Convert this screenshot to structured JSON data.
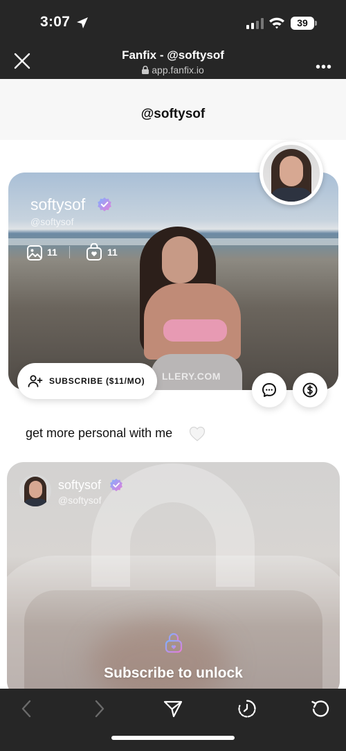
{
  "status_bar": {
    "time": "3:07",
    "battery": "39"
  },
  "browser": {
    "title": "Fanfix - @softysof",
    "url": "app.fanfix.io"
  },
  "page": {
    "title": "@softysof"
  },
  "profile": {
    "name": "softysof",
    "handle": "@softysof",
    "photo_count": "11",
    "bundle_count": "11",
    "watermark": "LLERY.COM",
    "subscribe_label": "SUBSCRIBE ($11/MO)",
    "bio": "get more personal with me"
  },
  "post": {
    "name": "softysof",
    "handle": "@softysof",
    "unlock_text": "Subscribe to unlock"
  },
  "colors": {
    "accent_gradient": [
      "#7fb0ff",
      "#e57cd8"
    ],
    "chrome": "#262626"
  }
}
